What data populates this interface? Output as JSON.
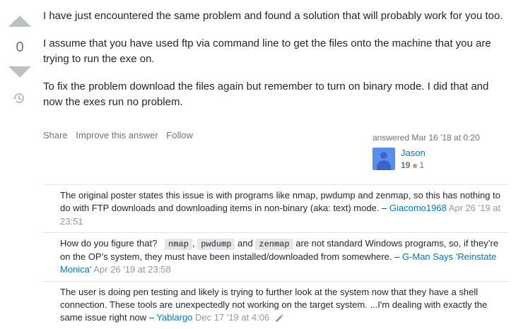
{
  "vote": {
    "score": "0"
  },
  "answer": {
    "paragraphs": [
      "I have just encountered the same problem and found a solution that will probably work for you too.",
      "I assume that you have used ftp via command line to get the files onto the machine that you are trying to run the exe on.",
      "To fix the problem download the files again but remember to turn on binary mode. I did that and now the exes run no problem."
    ]
  },
  "menu": {
    "share": "Share",
    "improve": "Improve this answer",
    "follow": "Follow"
  },
  "user": {
    "action": "answered Mar 16 '18 at 0:20",
    "name": "Jason",
    "reputation": "19",
    "bronze": "1"
  },
  "comments": [
    {
      "text": "The original poster states this issue is with programs like nmap, pwdump and zenmap, so this has nothing to do with FTP downloads and downloading items in non-binary (aka: text) mode. –",
      "user": "Giacomo1968",
      "date": "Apr 26 '19 at 23:51"
    },
    {
      "text_before": "How do you figure that?",
      "code1": "nmap",
      "code2": "pwdump",
      "and": "and",
      "code3": "zenmap",
      "text_after": "are not standard Windows programs, so, if they’re on the OP’s system, they must have been installed/downloaded from somewhere. –",
      "user": "G-Man Says 'Reinstate Monica'",
      "date": "Apr 26 '19 at 23:58"
    },
    {
      "text": "The user is doing pen testing and likely is trying to further look at the system now that they have a shell connection. These tools are unexpectedly not working on the target system. ...I'm dealing with exactly the same issue right now –",
      "user": "Yablargo",
      "date": "Dec 17 '19 at 4:06"
    }
  ]
}
